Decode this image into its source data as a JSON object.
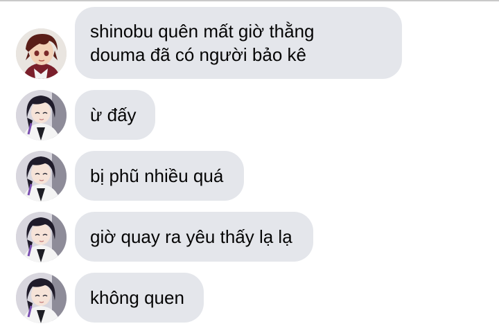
{
  "messages": [
    {
      "avatar_icon": "tanjiro-avatar-icon",
      "lines": [
        "shinobu quên mất giờ thằng",
        "douma đã có người bảo kê"
      ]
    },
    {
      "avatar_icon": "shinobu-avatar-icon",
      "lines": [
        "ừ đấy"
      ]
    },
    {
      "avatar_icon": "shinobu-avatar-icon",
      "lines": [
        "bị phũ nhiều quá"
      ]
    },
    {
      "avatar_icon": "shinobu-avatar-icon",
      "lines": [
        "giờ quay ra yêu thấy lạ lạ"
      ]
    },
    {
      "avatar_icon": "shinobu-avatar-icon",
      "lines": [
        "không quen"
      ]
    }
  ],
  "colors": {
    "bubble_bg": "#e4e6eb",
    "text": "#050505",
    "background": "#ffffff"
  }
}
